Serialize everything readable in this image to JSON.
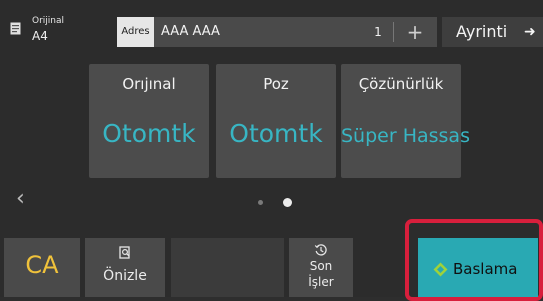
{
  "header": {
    "original_label": "Orijinal",
    "original_size": "A4",
    "address_label": "Adres",
    "address_value": "AAA AAA",
    "address_count": "1",
    "add_symbol": "+",
    "detail_label": "Ayrinti",
    "detail_arrow": "➜"
  },
  "cards": [
    {
      "title": "Orıjınal",
      "value": "Otomtk"
    },
    {
      "title": "Poz",
      "value": "Otomtk"
    },
    {
      "title": "Çözünürlük",
      "value": "Süper Hassas"
    }
  ],
  "pager": {
    "back_arrow": "‹",
    "page_count": 2,
    "current_page": 2
  },
  "bottom": {
    "ca_label": "CA",
    "preview_label": "Önizle",
    "recent_label_line1": "Son",
    "recent_label_line2": "İşler",
    "start_label": "Baslama"
  },
  "icons": {
    "document": "document-icon",
    "preview": "preview-icon",
    "recent": "history-icon",
    "start": "start-diamond-icon"
  },
  "colors": {
    "accent": "#38b6c4",
    "start_button": "#29a9b3",
    "highlight_frame": "#d81f3c",
    "ca_text": "#f0c23b"
  }
}
